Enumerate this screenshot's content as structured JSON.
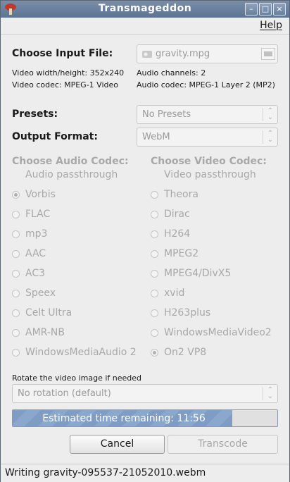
{
  "window": {
    "title": "Transmageddon"
  },
  "menu": {
    "help": "Help"
  },
  "input": {
    "label": "Choose Input File:",
    "file": "gravity.mpg",
    "video_size": "Video width/height: 352x240",
    "video_codec": "Video codec: MPEG-1 Video",
    "audio_channels": "Audio channels: 2",
    "audio_codec": "Audio codec: MPEG-1 Layer 2 (MP2)"
  },
  "presets": {
    "label": "Presets:",
    "value": "No Presets"
  },
  "output": {
    "label": "Output Format:",
    "value": "WebM"
  },
  "audio": {
    "heading": "Choose Audio Codec:",
    "options": [
      {
        "label": "Audio passthrough",
        "selected": false,
        "radio": false
      },
      {
        "label": "Vorbis",
        "selected": true,
        "radio": true
      },
      {
        "label": "FLAC",
        "selected": false,
        "radio": true
      },
      {
        "label": "mp3",
        "selected": false,
        "radio": true
      },
      {
        "label": "AAC",
        "selected": false,
        "radio": true
      },
      {
        "label": "AC3",
        "selected": false,
        "radio": true
      },
      {
        "label": "Speex",
        "selected": false,
        "radio": true
      },
      {
        "label": "Celt Ultra",
        "selected": false,
        "radio": true
      },
      {
        "label": "AMR-NB",
        "selected": false,
        "radio": true
      },
      {
        "label": "WindowsMediaAudio 2",
        "selected": false,
        "radio": true
      }
    ]
  },
  "video": {
    "heading": "Choose Video Codec:",
    "options": [
      {
        "label": "Video passthrough",
        "selected": false,
        "radio": false
      },
      {
        "label": "Theora",
        "selected": false,
        "radio": true
      },
      {
        "label": "Dirac",
        "selected": false,
        "radio": true
      },
      {
        "label": "H264",
        "selected": false,
        "radio": true
      },
      {
        "label": "MPEG2",
        "selected": false,
        "radio": true
      },
      {
        "label": "MPEG4/DivX5",
        "selected": false,
        "radio": true
      },
      {
        "label": "xvid",
        "selected": false,
        "radio": true
      },
      {
        "label": "H263plus",
        "selected": false,
        "radio": true
      },
      {
        "label": "WindowsMediaVideo2",
        "selected": false,
        "radio": true
      },
      {
        "label": "On2 VP8",
        "selected": true,
        "radio": true
      }
    ]
  },
  "rotate": {
    "label": "Rotate the video image if needed",
    "value": "No rotation (default)"
  },
  "progress": {
    "text": "Estimated time remaining: 11:56",
    "fraction": 0.83
  },
  "buttons": {
    "cancel": "Cancel",
    "transcode": "Transcode"
  },
  "status": {
    "text": "Writing gravity-095537-21052010.webm"
  },
  "colors": {
    "titlebar": "#6a809e",
    "progress": "#7f9cc4"
  }
}
